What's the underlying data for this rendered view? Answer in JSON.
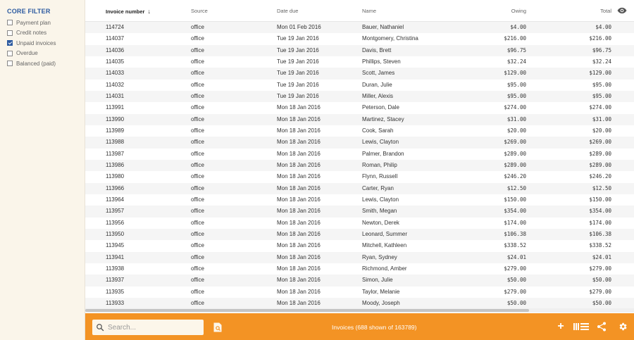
{
  "sidebar": {
    "title": "CORE FILTER",
    "filters": [
      {
        "label": "Payment plan",
        "checked": false
      },
      {
        "label": "Credit notes",
        "checked": false
      },
      {
        "label": "Unpaid invoices",
        "checked": true
      },
      {
        "label": "Overdue",
        "checked": false
      },
      {
        "label": "Balanced (paid)",
        "checked": false
      }
    ]
  },
  "table": {
    "columns": [
      "Invoice number",
      "Source",
      "Date due",
      "Name",
      "Owing",
      "Total"
    ],
    "sort_icon": "arrow-down-icon",
    "visibility_icon": "eye-icon",
    "rows": [
      [
        "114724",
        "office",
        "Mon 01 Feb 2016",
        "Bauer, Nathaniel",
        "$4.00",
        "$4.00"
      ],
      [
        "114037",
        "office",
        "Tue 19 Jan 2016",
        "Montgomery, Christina",
        "$216.00",
        "$216.00"
      ],
      [
        "114036",
        "office",
        "Tue 19 Jan 2016",
        "Davis, Brett",
        "$96.75",
        "$96.75"
      ],
      [
        "114035",
        "office",
        "Tue 19 Jan 2016",
        "Phillips, Steven",
        "$32.24",
        "$32.24"
      ],
      [
        "114033",
        "office",
        "Tue 19 Jan 2016",
        "Scott, James",
        "$129.00",
        "$129.00"
      ],
      [
        "114032",
        "office",
        "Tue 19 Jan 2016",
        "Duran, Julie",
        "$95.00",
        "$95.00"
      ],
      [
        "114031",
        "office",
        "Tue 19 Jan 2016",
        "Miller, Alexis",
        "$95.00",
        "$95.00"
      ],
      [
        "113991",
        "office",
        "Mon 18 Jan 2016",
        "Peterson, Dale",
        "$274.00",
        "$274.00"
      ],
      [
        "113990",
        "office",
        "Mon 18 Jan 2016",
        "Martinez, Stacey",
        "$31.00",
        "$31.00"
      ],
      [
        "113989",
        "office",
        "Mon 18 Jan 2016",
        "Cook, Sarah",
        "$20.00",
        "$20.00"
      ],
      [
        "113988",
        "office",
        "Mon 18 Jan 2016",
        "Lewis, Clayton",
        "$269.00",
        "$269.00"
      ],
      [
        "113987",
        "office",
        "Mon 18 Jan 2016",
        "Palmer, Brandon",
        "$289.00",
        "$289.00"
      ],
      [
        "113986",
        "office",
        "Mon 18 Jan 2016",
        "Roman, Philip",
        "$289.00",
        "$289.00"
      ],
      [
        "113980",
        "office",
        "Mon 18 Jan 2016",
        "Flynn, Russell",
        "$246.20",
        "$246.20"
      ],
      [
        "113966",
        "office",
        "Mon 18 Jan 2016",
        "Carter, Ryan",
        "$12.50",
        "$12.50"
      ],
      [
        "113964",
        "office",
        "Mon 18 Jan 2016",
        "Lewis, Clayton",
        "$150.00",
        "$150.00"
      ],
      [
        "113957",
        "office",
        "Mon 18 Jan 2016",
        "Smith, Megan",
        "$354.00",
        "$354.00"
      ],
      [
        "113956",
        "office",
        "Mon 18 Jan 2016",
        "Newton, Derek",
        "$174.00",
        "$174.00"
      ],
      [
        "113950",
        "office",
        "Mon 18 Jan 2016",
        "Leonard, Summer",
        "$106.38",
        "$106.38"
      ],
      [
        "113945",
        "office",
        "Mon 18 Jan 2016",
        "Mitchell, Kathleen",
        "$338.52",
        "$338.52"
      ],
      [
        "113941",
        "office",
        "Mon 18 Jan 2016",
        "Ryan, Sydney",
        "$24.01",
        "$24.01"
      ],
      [
        "113938",
        "office",
        "Mon 18 Jan 2016",
        "Richmond, Amber",
        "$279.00",
        "$279.00"
      ],
      [
        "113937",
        "office",
        "Mon 18 Jan 2016",
        "Simon, Julie",
        "$50.00",
        "$50.00"
      ],
      [
        "113935",
        "office",
        "Mon 18 Jan 2016",
        "Taylor, Melanie",
        "$279.00",
        "$279.00"
      ],
      [
        "113933",
        "office",
        "Mon 18 Jan 2016",
        "Moody, Joseph",
        "$50.00",
        "$50.00"
      ]
    ]
  },
  "footer": {
    "search_placeholder": "Search...",
    "status": "Invoices (688 shown of 163789)",
    "icons": [
      "search-icon",
      "document-icon",
      "add-icon",
      "list-view-icon",
      "share-icon",
      "settings-icon"
    ]
  },
  "colors": {
    "accent": "#f39324",
    "filter_title": "#2c5aa0",
    "sidebar_bg": "#faf5ea",
    "row_alt": "#f5f5f5"
  }
}
